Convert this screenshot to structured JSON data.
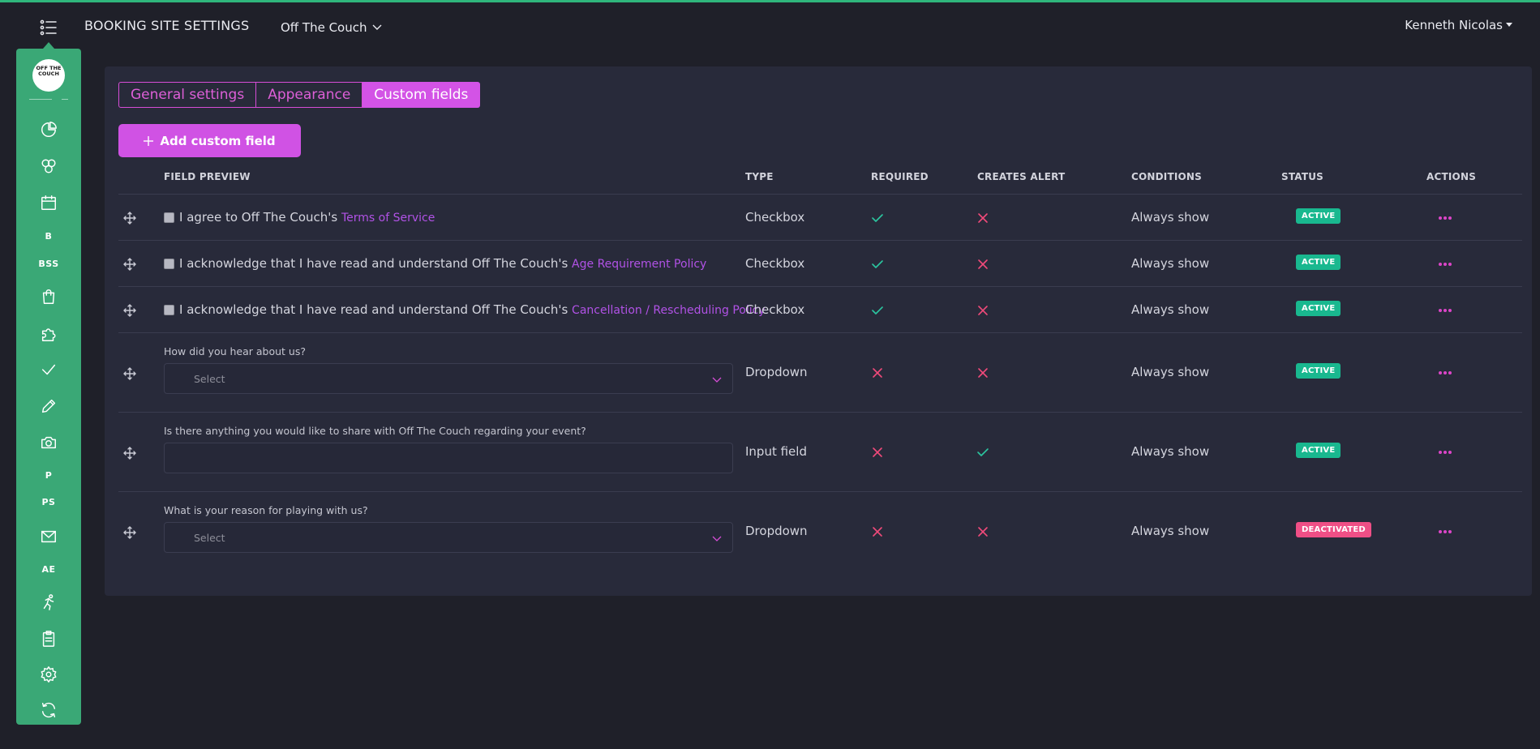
{
  "header": {
    "title": "BOOKING SITE SETTINGS",
    "venue": "Off The Couch",
    "user": "Kenneth Nicolas"
  },
  "sidebar": {
    "logo_text": "OFF THE COUCH",
    "items": [
      {
        "icon": "pie-chart-icon"
      },
      {
        "icon": "circles-icon"
      },
      {
        "icon": "calendar-icon"
      },
      {
        "label": "B"
      },
      {
        "label": "BSS"
      },
      {
        "icon": "shopping-bag-icon"
      },
      {
        "icon": "puzzle-icon"
      },
      {
        "icon": "check-icon"
      },
      {
        "icon": "pencil-icon"
      },
      {
        "icon": "camera-icon"
      },
      {
        "label": "P"
      },
      {
        "label": "PS"
      },
      {
        "icon": "mail-icon"
      },
      {
        "label": "AE"
      },
      {
        "icon": "runner-icon"
      },
      {
        "icon": "clipboard-icon"
      },
      {
        "icon": "gear-icon"
      },
      {
        "icon": "refresh-icon"
      }
    ]
  },
  "tabs": [
    {
      "label": "General settings",
      "active": false
    },
    {
      "label": "Appearance",
      "active": false
    },
    {
      "label": "Custom fields",
      "active": true
    }
  ],
  "add_button": "Add custom field",
  "columns": {
    "field_preview": "FIELD PREVIEW",
    "type": "TYPE",
    "required": "REQUIRED",
    "creates_alert": "CREATES ALERT",
    "conditions": "CONDITIONS",
    "status": "STATUS",
    "actions": "ACTIONS"
  },
  "rows": [
    {
      "kind": "checkbox",
      "text": "I agree to Off The Couch's ",
      "link": "Terms of Service",
      "type": "Checkbox",
      "required": true,
      "alert": false,
      "conditions": "Always show",
      "status": "ACTIVE"
    },
    {
      "kind": "checkbox",
      "text": "I acknowledge that I have read and understand Off The Couch's ",
      "link": "Age Requirement Policy",
      "type": "Checkbox",
      "required": true,
      "alert": false,
      "conditions": "Always show",
      "status": "ACTIVE"
    },
    {
      "kind": "checkbox",
      "text": "I acknowledge that I have read and understand Off The Couch's ",
      "link": "Cancellation / Rescheduling Policy",
      "type": "Checkbox",
      "required": true,
      "alert": false,
      "conditions": "Always show",
      "status": "ACTIVE"
    },
    {
      "kind": "dropdown",
      "question": "How did you hear about us?",
      "placeholder": "Select",
      "type": "Dropdown",
      "required": false,
      "alert": false,
      "conditions": "Always show",
      "status": "ACTIVE"
    },
    {
      "kind": "input",
      "question": "Is there anything you would like to share with Off The Couch regarding your event?",
      "type": "Input field",
      "required": false,
      "alert": true,
      "conditions": "Always show",
      "status": "ACTIVE"
    },
    {
      "kind": "dropdown",
      "question": "What is your reason for playing with us?",
      "placeholder": "Select",
      "type": "Dropdown",
      "required": false,
      "alert": false,
      "conditions": "Always show",
      "status": "DEACTIVATED"
    }
  ],
  "colors": {
    "accent": "#d353e6",
    "sidebar": "#3aa876",
    "check": "#2bc6a0",
    "cross": "#f04a7a",
    "active_badge": "#19b88f",
    "deactivated_badge": "#ef4f86"
  }
}
